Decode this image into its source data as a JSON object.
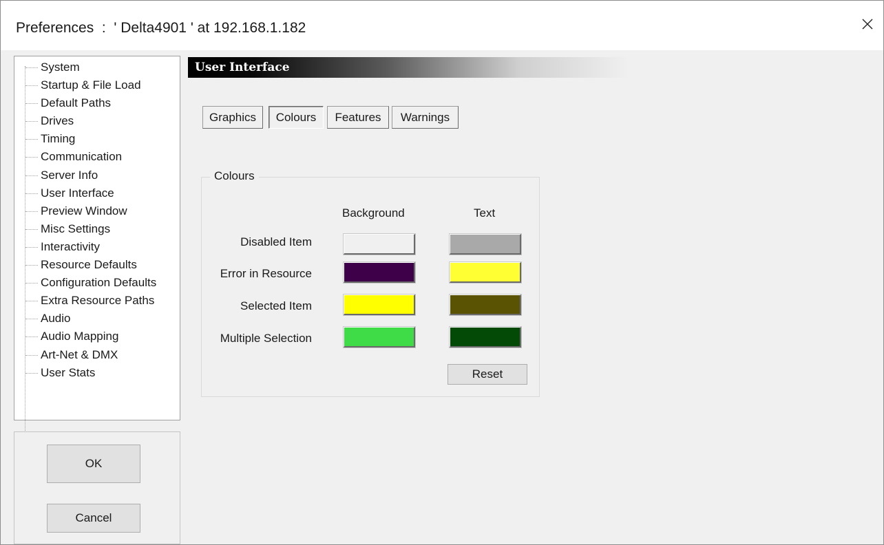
{
  "window": {
    "title": "Preferences  :  ' Delta4901 ' at 192.168.1.182",
    "close_icon": "close-icon"
  },
  "sidebar": {
    "items": [
      {
        "label": "System"
      },
      {
        "label": "Startup & File Load"
      },
      {
        "label": "Default Paths"
      },
      {
        "label": "Drives"
      },
      {
        "label": "Timing"
      },
      {
        "label": "Communication"
      },
      {
        "label": "Server Info"
      },
      {
        "label": "User Interface"
      },
      {
        "label": "Preview Window"
      },
      {
        "label": "Misc Settings"
      },
      {
        "label": "Interactivity"
      },
      {
        "label": "Resource Defaults"
      },
      {
        "label": "Configuration Defaults"
      },
      {
        "label": "Extra Resource Paths"
      },
      {
        "label": "Audio"
      },
      {
        "label": "Audio Mapping"
      },
      {
        "label": "Art-Net & DMX"
      },
      {
        "label": "User Stats"
      }
    ]
  },
  "buttons": {
    "ok": "OK",
    "cancel": "Cancel"
  },
  "section": {
    "title": "User Interface"
  },
  "tabs": [
    {
      "label": "Graphics",
      "active": false
    },
    {
      "label": "Colours",
      "active": true
    },
    {
      "label": "Features",
      "active": false
    },
    {
      "label": "Warnings",
      "active": false
    }
  ],
  "colours": {
    "group_title": "Colours",
    "columns": [
      "Background",
      "Text"
    ],
    "rows": [
      {
        "label": "Disabled Item",
        "background": "#f0f0f0",
        "text": "#a9a9a9"
      },
      {
        "label": "Error in Resource",
        "background": "#3e0048",
        "text": "#ffff33"
      },
      {
        "label": "Selected Item",
        "background": "#ffff00",
        "text": "#595303"
      },
      {
        "label": "Multiple Selection",
        "background": "#3fdc48",
        "text": "#024a06"
      }
    ],
    "reset_label": "Reset"
  }
}
